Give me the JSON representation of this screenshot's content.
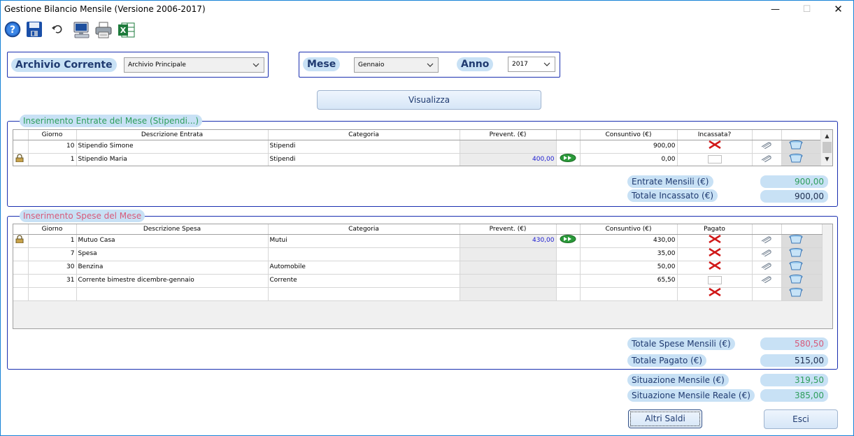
{
  "window": {
    "title": "Gestione Bilancio Mensile (Versione 2006-2017)"
  },
  "toolbar": {
    "icons": [
      "help-icon",
      "save-icon",
      "undo-icon",
      "computer-icon",
      "printer-icon",
      "excel-icon"
    ]
  },
  "archivio": {
    "label": "Archivio Corrente",
    "value": "Archivio Principale"
  },
  "periodo": {
    "mese_label": "Mese",
    "mese_value": "Gennaio",
    "anno_label": "Anno",
    "anno_value": "2017"
  },
  "visualizza_label": "Visualizza",
  "entrate": {
    "title": "Inserimento Entrate del Mese (Stipendi...)",
    "headers": [
      "Giorno",
      "Descrizione Entrata",
      "Categoria",
      "Prevent. (€)",
      "Consuntivo (€)",
      "Incassata?"
    ],
    "rows": [
      {
        "giorno": "10",
        "descrizione": "Stipendio Simone",
        "categoria": "Stipendi",
        "prevent": "",
        "consuntivo": "900,00",
        "stato": "x",
        "locked": false
      },
      {
        "giorno": "1",
        "descrizione": "Stipendio Maria",
        "categoria": "Stipendi",
        "prevent": "400,00",
        "consuntivo": "0,00",
        "stato": "box",
        "locked": true
      }
    ],
    "summary": [
      {
        "label": "Entrate Mensili (€)",
        "value": "900,00",
        "color": "#2e9e5c"
      },
      {
        "label": "Totale Incassato (€)",
        "value": "900,00",
        "color": "#1f2f50"
      }
    ]
  },
  "spese": {
    "title": "Inserimento Spese del Mese",
    "headers": [
      "Giorno",
      "Descrizione Spesa",
      "Categoria",
      "Prevent. (€)",
      "Consuntivo (€)",
      "Pagato"
    ],
    "rows": [
      {
        "giorno": "1",
        "descrizione": "Mutuo Casa",
        "categoria": "Mutui",
        "prevent": "430,00",
        "consuntivo": "430,00",
        "stato": "x",
        "locked": true
      },
      {
        "giorno": "7",
        "descrizione": "Spesa",
        "categoria": "",
        "prevent": "",
        "consuntivo": "35,00",
        "stato": "x",
        "locked": false
      },
      {
        "giorno": "30",
        "descrizione": "Benzina",
        "categoria": "Automobile",
        "prevent": "",
        "consuntivo": "50,00",
        "stato": "x",
        "locked": false
      },
      {
        "giorno": "31",
        "descrizione": "Corrente bimestre dicembre-gennaio",
        "categoria": "Corrente",
        "prevent": "",
        "consuntivo": "65,50",
        "stato": "box",
        "locked": false
      }
    ],
    "summary": [
      {
        "label": "Totale Spese Mensili (€)",
        "value": "580,50",
        "color": "#d75a7a"
      },
      {
        "label": "Totale Pagato (€)",
        "value": "515,00",
        "color": "#1f2f50"
      }
    ]
  },
  "situazione": [
    {
      "label": "Situazione Mensile (€)",
      "value": "319,50",
      "color": "#2e9e5c"
    },
    {
      "label": "Situazione Mensile Reale (€)",
      "value": "385,00",
      "color": "#2e9e5c"
    }
  ],
  "buttons": {
    "altri_saldi": "Altri Saldi",
    "esci": "Esci"
  }
}
